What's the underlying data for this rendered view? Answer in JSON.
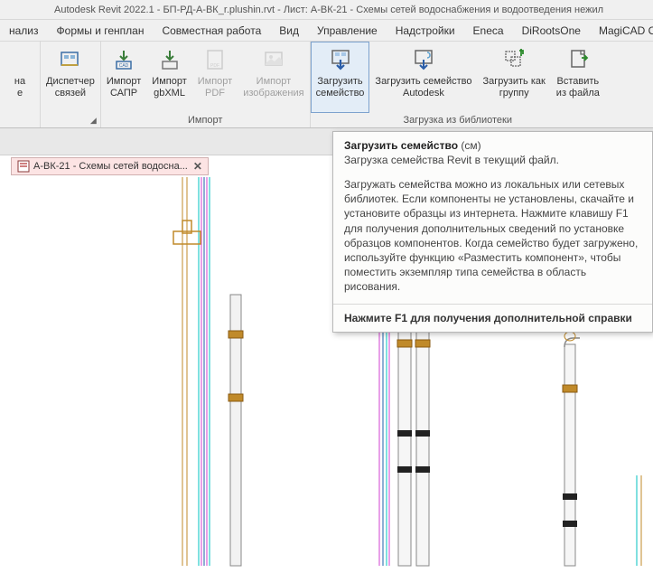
{
  "titlebar": "Autodesk Revit 2022.1 - БП-РД-А-ВК_r.plushin.rvt - Лист: А-ВК-21 - Схемы сетей водоснабжения и водоотведения нежил",
  "menu": {
    "analysis": "нализ",
    "forms": "Формы и генплан",
    "collab": "Совместная работа",
    "view": "Вид",
    "manage": "Управление",
    "addins": "Надстройки",
    "eneca": "Eneca",
    "diroots": "DiRootsOne",
    "magicad": "MagiCAD Общ"
  },
  "ribbon": {
    "btn_na": "на",
    "btn_na2": "е",
    "dispatcher1": "Диспетчер",
    "dispatcher2": "связей",
    "import_sapr1": "Импорт",
    "import_sapr2": "САПР",
    "import_gbxml1": "Импорт",
    "import_gbxml2": "gbXML",
    "import_pdf1": "Импорт",
    "import_pdf2": "PDF",
    "import_img1": "Импорт",
    "import_img2": "изображения",
    "load_family1": "Загрузить",
    "load_family2": "семейство",
    "load_autodesk1": "Загрузить семейство",
    "load_autodesk2": "Autodesk",
    "load_group1": "Загрузить как",
    "load_group2": "группу",
    "insert_file1": "Вставить",
    "insert_file2": "из файла",
    "group_import": "Импорт",
    "group_library": "Загрузка из библиотеки"
  },
  "tab": {
    "label": "А-ВК-21 - Схемы сетей водосна..."
  },
  "tooltip": {
    "title_bold": "Загрузить семейство",
    "title_suffix": " (см)",
    "desc": "Загрузка семейства Revit в текущий файл.",
    "body": "Загружать семейства можно из локальных или сетевых библиотек. Если компоненты не установлены, скачайте и установите образцы из интернета. Нажмите клавишу F1 для получения дополнительных сведений по установке образцов компонентов. Когда семейство будет загружено, используйте функцию «Разместить компонент», чтобы поместить экземпляр типа семейства в область рисования.",
    "footer": "Нажмите F1 для получения дополнительной справки"
  }
}
